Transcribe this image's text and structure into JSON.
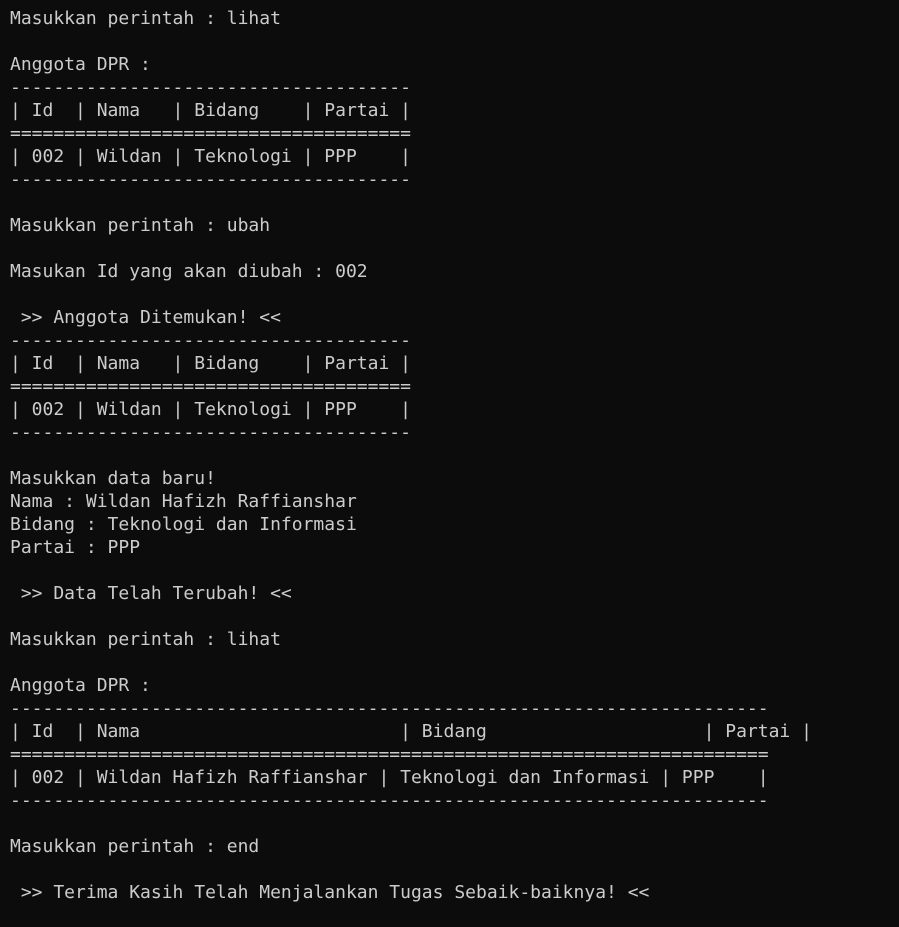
{
  "terminal": {
    "lines": [
      "Masukkan perintah : lihat",
      "",
      "Anggota DPR :",
      "-------------------------------------",
      "| Id  | Nama   | Bidang    | Partai |",
      "=====================================",
      "| 002 | Wildan | Teknologi | PPP    |",
      "-------------------------------------",
      "",
      "Masukkan perintah : ubah",
      "",
      "Masukan Id yang akan diubah : 002",
      "",
      " >> Anggota Ditemukan! <<",
      "-------------------------------------",
      "| Id  | Nama   | Bidang    | Partai |",
      "=====================================",
      "| 002 | Wildan | Teknologi | PPP    |",
      "-------------------------------------",
      "",
      "Masukkan data baru!",
      "Nama : Wildan Hafizh Raffianshar",
      "Bidang : Teknologi dan Informasi",
      "Partai : PPP",
      "",
      " >> Data Telah Terubah! <<",
      "",
      "Masukkan perintah : lihat",
      "",
      "Anggota DPR :",
      "----------------------------------------------------------------------",
      "| Id  | Nama                        | Bidang                    | Partai |",
      "======================================================================",
      "| 002 | Wildan Hafizh Raffianshar | Teknologi dan Informasi | PPP    |",
      "----------------------------------------------------------------------",
      "",
      "Masukkan perintah : end",
      "",
      " >> Terima Kasih Telah Menjalankan Tugas Sebaik-baiknya! <<"
    ]
  }
}
